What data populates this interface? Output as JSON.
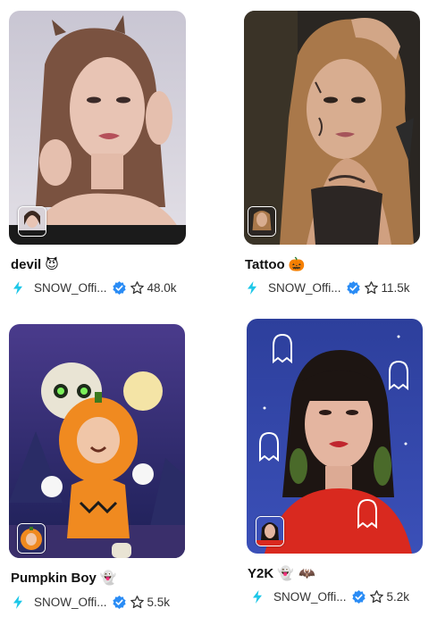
{
  "colors": {
    "bolt": "#1cc7e8",
    "verified": "#2a8cf5",
    "text": "#111111",
    "meta_text": "#333333"
  },
  "icons": {
    "creator": "lightning-bolt-icon",
    "verified": "verified-badge-icon",
    "favorite": "star-outline-icon"
  },
  "cards": [
    {
      "title": "devil",
      "emoji": "😈",
      "creator": "SNOW_Offi...",
      "likes": "48.0k"
    },
    {
      "title": "Tattoo",
      "emoji": "🎃",
      "creator": "SNOW_Offi...",
      "likes": "11.5k"
    },
    {
      "title": "Pumpkin Boy",
      "emoji": "👻",
      "creator": "SNOW_Offi...",
      "likes": "5.5k"
    },
    {
      "title": "Y2K",
      "emoji": "👻 🦇",
      "creator": "SNOW_Offi...",
      "likes": "5.2k"
    }
  ]
}
